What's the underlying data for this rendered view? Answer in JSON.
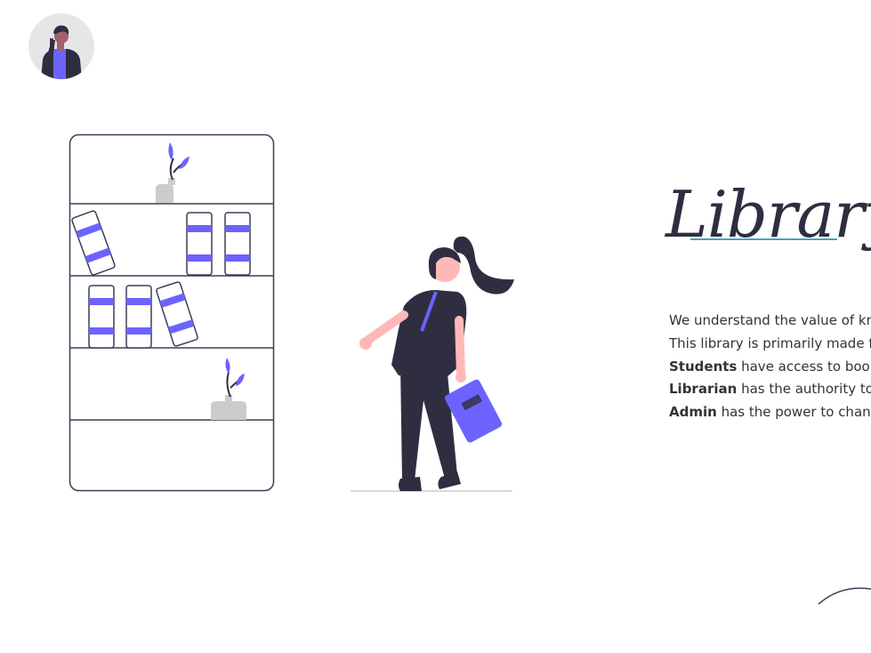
{
  "header": {
    "avatar_label": "user-avatar"
  },
  "hero": {
    "title": "Library"
  },
  "description": {
    "line1": "We understand the value of kno",
    "line2": "This library is primarily made for",
    "students": {
      "role": "Students",
      "text": " have access to books a"
    },
    "librarian": {
      "role": "Librarian",
      "text": " has the authority to up"
    },
    "admin": {
      "role": "Admin",
      "text": " has the power to change"
    }
  },
  "colors": {
    "accent": "#6c63ff",
    "dark": "#2f2e41",
    "skin": "#ffb8b8",
    "gray": "#cccccc",
    "underline": "#4aa3c4"
  }
}
